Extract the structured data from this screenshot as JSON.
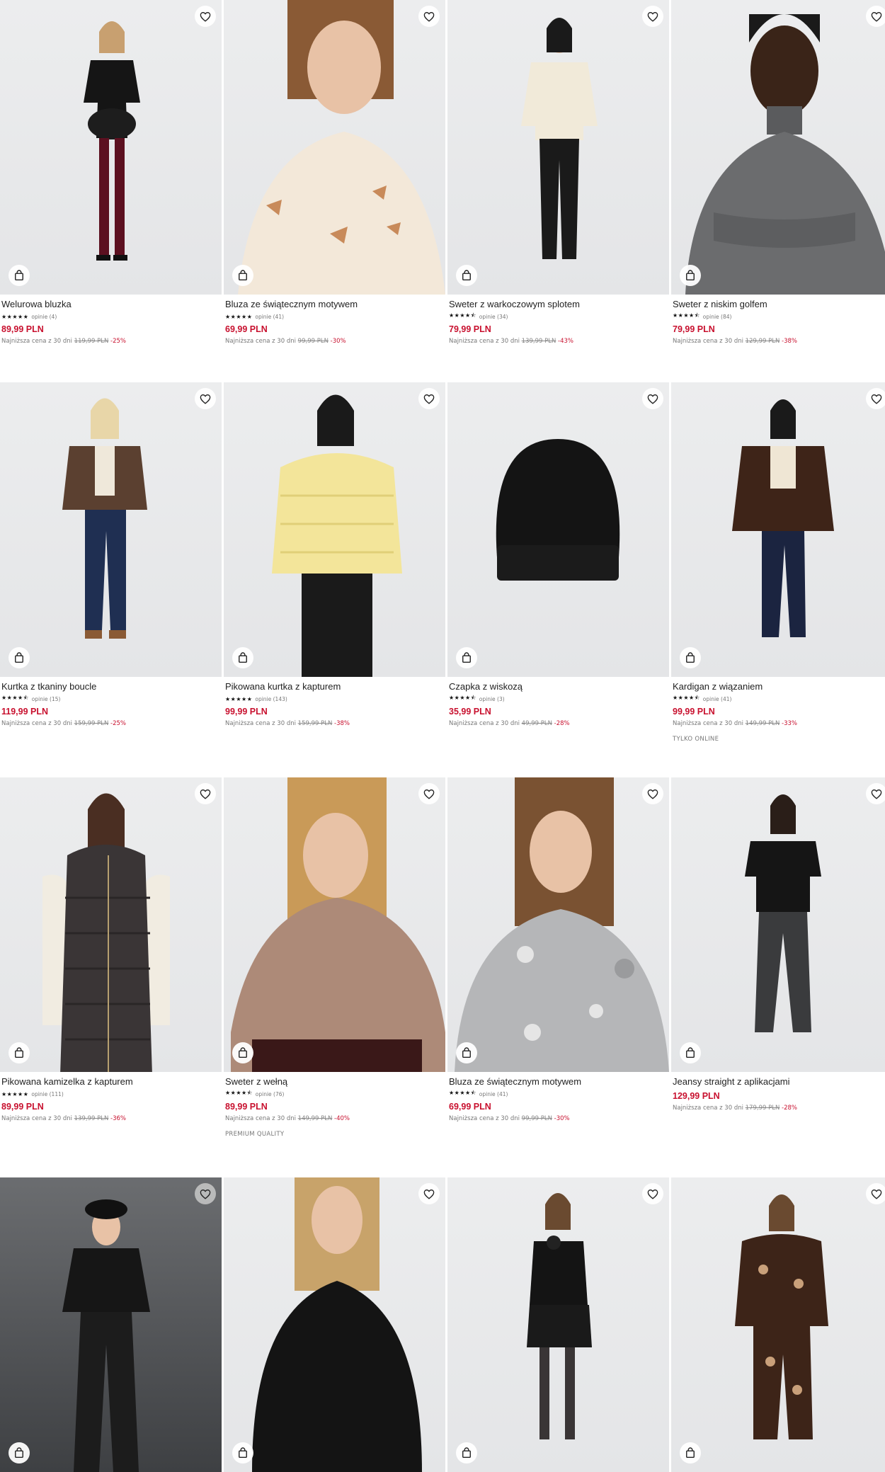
{
  "accent_color": "#c8102e",
  "lowest_label": "Najniższa cena z 30 dni",
  "products": [
    {
      "name": "Welurowa bluzka",
      "rating": 5,
      "reviews": "opinie (4)",
      "price": "89,99 PLN",
      "old_price": "119,99 PLN",
      "discount": "-25%",
      "tag": "",
      "fav_icon": "heart-icon",
      "cart_icon": "shopping-bag-icon",
      "figure": "dark-dress"
    },
    {
      "name": "Bluza ze świątecznym motywem",
      "rating": 5,
      "reviews": "opinie (41)",
      "price": "69,99 PLN",
      "old_price": "99,99 PLN",
      "discount": "-30%",
      "tag": "",
      "fav_icon": "heart-icon",
      "cart_icon": "shopping-bag-icon",
      "figure": "cream-hoodie-portrait"
    },
    {
      "name": "Sweter z warkoczowym splotem",
      "rating": 4.5,
      "reviews": "opinie (34)",
      "price": "79,99 PLN",
      "old_price": "139,99 PLN",
      "discount": "-43%",
      "tag": "",
      "fav_icon": "heart-icon",
      "cart_icon": "shopping-bag-icon",
      "figure": "cream-sweater"
    },
    {
      "name": "Sweter z niskim golfem",
      "rating": 4.5,
      "reviews": "opinie (84)",
      "price": "79,99 PLN",
      "old_price": "129,99 PLN",
      "discount": "-38%",
      "tag": "",
      "fav_icon": "heart-icon",
      "cart_icon": "shopping-bag-icon",
      "figure": "grey-turtleneck-portrait"
    },
    {
      "name": "Kurtka z tkaniny boucle",
      "rating": 4.5,
      "reviews": "opinie (15)",
      "price": "119,99 PLN",
      "old_price": "159,99 PLN",
      "discount": "-25%",
      "tag": "",
      "fav_icon": "heart-icon",
      "cart_icon": "shopping-bag-icon",
      "figure": "brown-jacket"
    },
    {
      "name": "Pikowana kurtka z kapturem",
      "rating": 5,
      "reviews": "opinie (143)",
      "price": "99,99 PLN",
      "old_price": "159,99 PLN",
      "discount": "-38%",
      "tag": "",
      "fav_icon": "heart-icon",
      "cart_icon": "shopping-bag-icon",
      "figure": "yellow-puffer"
    },
    {
      "name": "Czapka z wiskozą",
      "rating": 4.5,
      "reviews": "opinie (3)",
      "price": "35,99 PLN",
      "old_price": "49,99 PLN",
      "discount": "-28%",
      "tag": "",
      "fav_icon": "heart-icon",
      "cart_icon": "shopping-bag-icon",
      "figure": "beanie"
    },
    {
      "name": "Kardigan z wiązaniem",
      "rating": 4.5,
      "reviews": "opinie (41)",
      "price": "99,99 PLN",
      "old_price": "149,99 PLN",
      "discount": "-33%",
      "tag": "TYLKO ONLINE",
      "fav_icon": "heart-icon",
      "cart_icon": "shopping-bag-icon",
      "figure": "brown-cardigan"
    },
    {
      "name": "Pikowana kamizelka z kapturem",
      "rating": 5,
      "reviews": "opinie (111)",
      "price": "89,99 PLN",
      "old_price": "139,99 PLN",
      "discount": "-36%",
      "tag": "",
      "fav_icon": "heart-icon",
      "cart_icon": "shopping-bag-icon",
      "figure": "puffer-vest"
    },
    {
      "name": "Sweter z wełną",
      "rating": 4.5,
      "reviews": "opinie (76)",
      "price": "89,99 PLN",
      "old_price": "149,99 PLN",
      "discount": "-40%",
      "tag": "PREMIUM QUALITY",
      "fav_icon": "heart-icon",
      "cart_icon": "shopping-bag-icon",
      "figure": "beige-knit-portrait"
    },
    {
      "name": "Bluza ze świątecznym motywem",
      "rating": 4.5,
      "reviews": "opinie (41)",
      "price": "69,99 PLN",
      "old_price": "99,99 PLN",
      "discount": "-30%",
      "tag": "",
      "fav_icon": "heart-icon",
      "cart_icon": "shopping-bag-icon",
      "figure": "grey-hoodie-portrait"
    },
    {
      "name": "Jeansy straight z aplikacjami",
      "rating": 0,
      "reviews": "",
      "price": "129,99 PLN",
      "old_price": "179,99 PLN",
      "discount": "-28%",
      "tag": "",
      "fav_icon": "heart-icon",
      "cart_icon": "shopping-bag-icon",
      "figure": "black-tee-jeans"
    },
    {
      "name": "",
      "rating": 0,
      "reviews": "",
      "price": "",
      "old_price": "",
      "discount": "",
      "tag": "",
      "fav_icon": "heart-icon",
      "cart_icon": "shopping-bag-icon",
      "figure": "lace-set-dark"
    },
    {
      "name": "",
      "rating": 0,
      "reviews": "",
      "price": "",
      "old_price": "",
      "discount": "",
      "tag": "",
      "fav_icon": "heart-icon",
      "cart_icon": "shopping-bag-icon",
      "figure": "black-knit-top"
    },
    {
      "name": "",
      "rating": 0,
      "reviews": "",
      "price": "",
      "old_price": "",
      "discount": "",
      "tag": "",
      "fav_icon": "heart-icon",
      "cart_icon": "shopping-bag-icon",
      "figure": "black-one-shoulder"
    },
    {
      "name": "",
      "rating": 0,
      "reviews": "",
      "price": "",
      "old_price": "",
      "discount": "",
      "tag": "",
      "fav_icon": "heart-icon",
      "cart_icon": "shopping-bag-icon",
      "figure": "gingerbread-set"
    }
  ]
}
